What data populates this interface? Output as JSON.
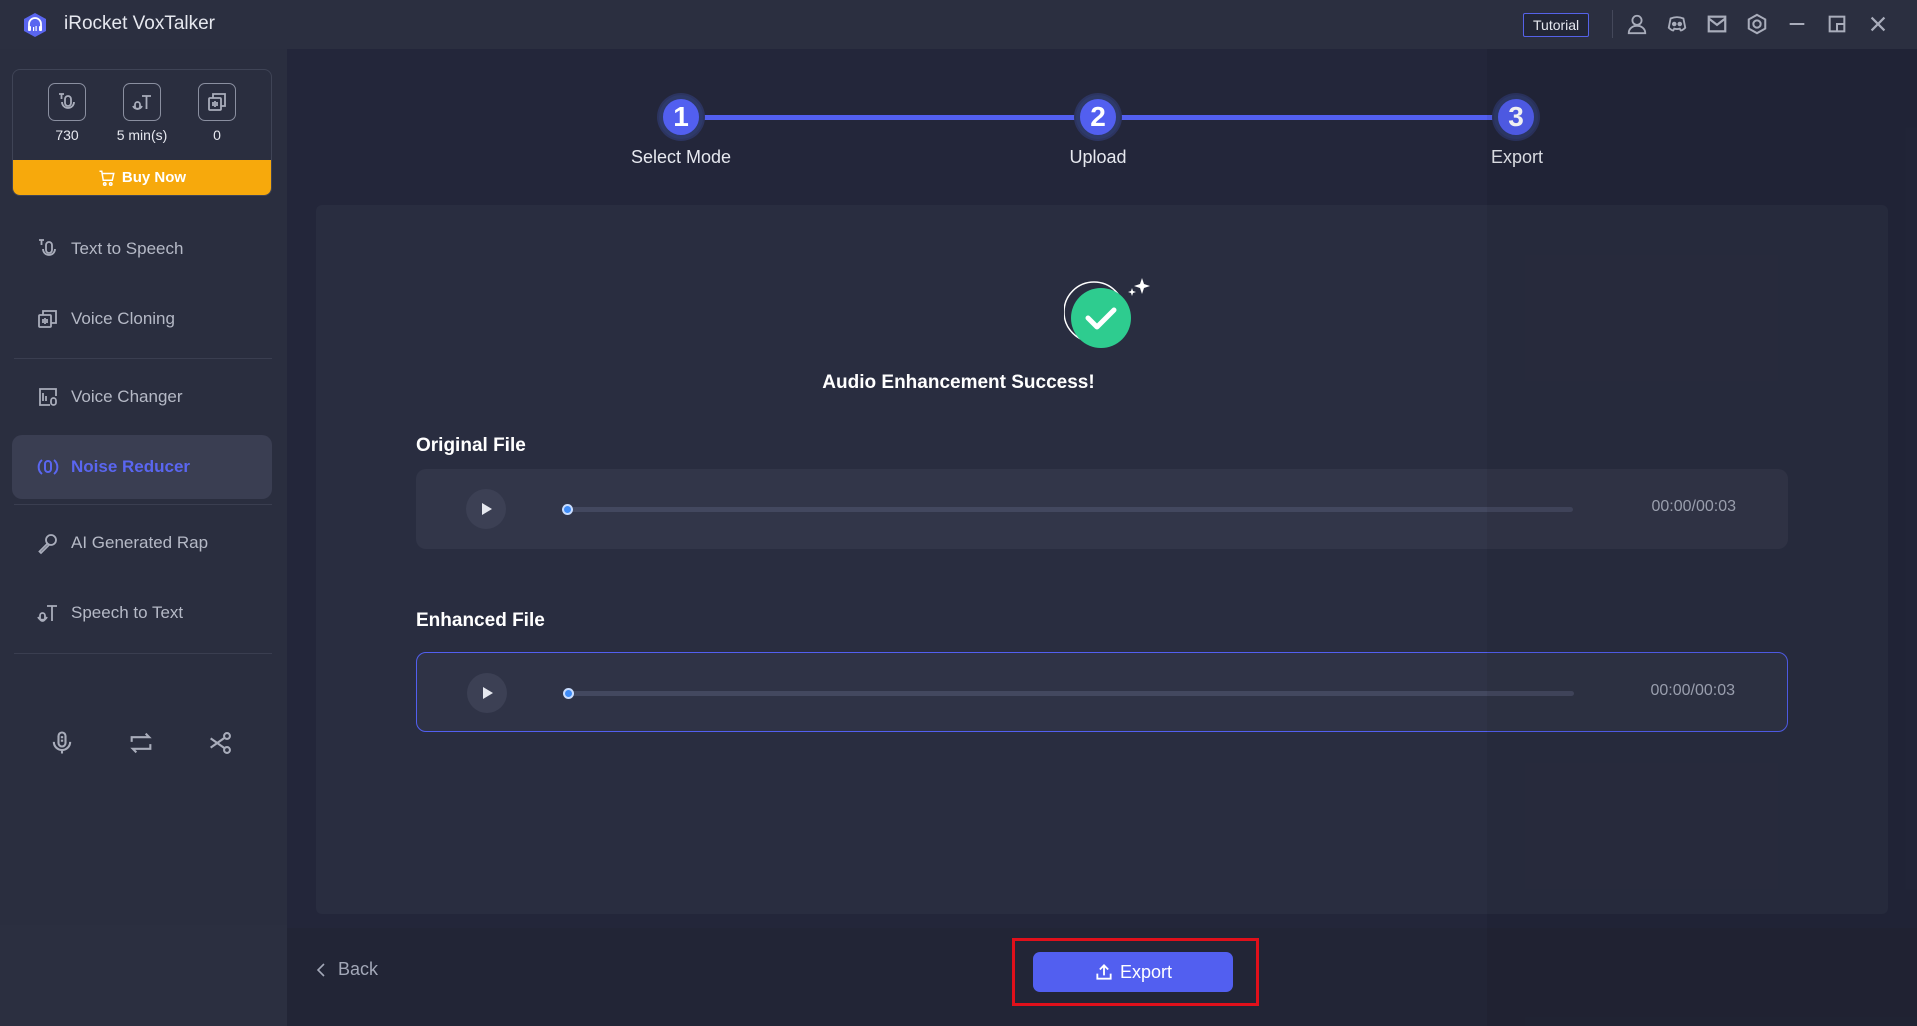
{
  "app": {
    "title": "iRocket VoxTalker"
  },
  "titlebar": {
    "tutorial_label": "Tutorial",
    "icons": [
      "user-icon",
      "discord-icon",
      "mail-icon",
      "settings-icon",
      "minimize-icon",
      "restore-icon",
      "close-icon"
    ]
  },
  "quota": {
    "items": [
      {
        "icon": "text-to-speech-icon",
        "value": "730"
      },
      {
        "icon": "speech-to-text-icon",
        "value": "5 min(s)"
      },
      {
        "icon": "voice-cloning-icon",
        "value": "0"
      }
    ],
    "buy_label": "Buy Now"
  },
  "sidebar": {
    "items": [
      {
        "label": "Text to Speech",
        "icon": "text-to-speech-icon",
        "active": false
      },
      {
        "label": "Voice Cloning",
        "icon": "voice-cloning-icon",
        "active": false
      },
      {
        "label": "Voice Changer",
        "icon": "voice-changer-icon",
        "active": false
      },
      {
        "label": "Noise Reducer",
        "icon": "noise-reducer-icon",
        "active": true
      },
      {
        "label": "AI Generated Rap",
        "icon": "microphone-icon",
        "active": false
      },
      {
        "label": "Speech to Text",
        "icon": "speech-to-text-icon",
        "active": false
      }
    ],
    "tools": [
      "voice-record-icon",
      "convert-icon",
      "cut-icon"
    ]
  },
  "stepper": {
    "steps": [
      {
        "number": "1",
        "label": "Select Mode"
      },
      {
        "number": "2",
        "label": "Upload"
      },
      {
        "number": "3",
        "label": "Export"
      }
    ],
    "current_step": 3
  },
  "result": {
    "title": "Audio Enhancement Success!",
    "original": {
      "label": "Original File",
      "time": "00:00/00:03",
      "progress": 0
    },
    "enhanced": {
      "label": "Enhanced File",
      "time": "00:00/00:03",
      "progress": 0
    }
  },
  "footer": {
    "back_label": "Back",
    "export_label": "Export"
  },
  "colors": {
    "accent": "#525ff0",
    "buy": "#f7a90c",
    "success": "#2ecc8f",
    "highlight": "#e0101b"
  }
}
